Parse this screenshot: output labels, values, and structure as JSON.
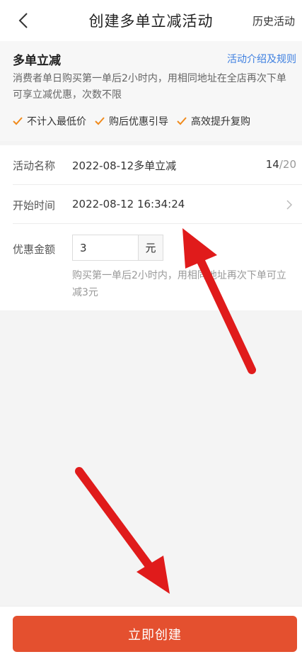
{
  "header": {
    "title": "创建多单立减活动",
    "right_link": "历史活动"
  },
  "intro": {
    "title": "多单立减",
    "rules_link": "活动介绍及规则",
    "description": "消费者单日购买第一单后2小时内，用相同地址在全店再次下单可享立减优惠，次数不限",
    "features": [
      "不计入最低价",
      "购后优惠引导",
      "高效提升复购"
    ]
  },
  "form": {
    "name": {
      "label": "活动名称",
      "value": "2022-08-12多单立减",
      "count": "14",
      "max": "/20"
    },
    "start_time": {
      "label": "开始时间",
      "value": "2022-08-12 16:34:24"
    },
    "discount": {
      "label": "优惠金额",
      "value": "3",
      "unit": "元",
      "hint": "购买第一单后2小时内，用相同地址再次下单可立减3元"
    }
  },
  "submit_label": "立即创建",
  "colors": {
    "accent": "#e4502f",
    "link": "#3d7fe0",
    "check": "#f08a1c",
    "annotation_arrow": "#e01b1b"
  }
}
